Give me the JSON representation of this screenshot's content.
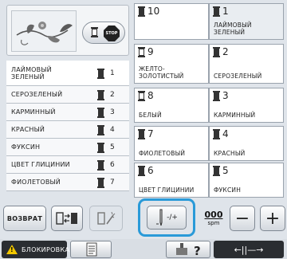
{
  "list": {
    "items": [
      {
        "name": "ЛАЙМОВЫЙ\nЗЕЛЕНЫЙ",
        "num": "1"
      },
      {
        "name": "СЕРОЗЕЛЕНЫЙ",
        "num": "2"
      },
      {
        "name": "КАРМИННЫЙ",
        "num": "3"
      },
      {
        "name": "КРАСНЫЙ",
        "num": "4"
      },
      {
        "name": "ФУКСИН",
        "num": "5"
      },
      {
        "name": "ЦВЕТ ГЛИЦИНИИ",
        "num": "6"
      },
      {
        "name": "ФИОЛЕТОВЫЙ",
        "num": "7"
      }
    ]
  },
  "grid": {
    "cells": [
      {
        "num": "10",
        "name": ""
      },
      {
        "num": "1",
        "name": "ЛАЙМОВЫЙ\nЗЕЛЕНЫЙ"
      },
      {
        "num": "9",
        "name": "ЖЕЛТО-\nЗОЛОТИСТЫЙ"
      },
      {
        "num": "2",
        "name": "СЕРОЗЕЛЕНЫЙ"
      },
      {
        "num": "8",
        "name": "БЕЛЫЙ"
      },
      {
        "num": "3",
        "name": "КАРМИННЫЙ"
      },
      {
        "num": "7",
        "name": "ФИОЛЕТОВЫЙ"
      },
      {
        "num": "4",
        "name": "КРАСНЫЙ"
      },
      {
        "num": "6",
        "name": "ЦВЕТ ГЛИЦИНИИ"
      },
      {
        "num": "5",
        "name": "ФУКСИН"
      }
    ]
  },
  "buttons": {
    "back": "ВОЗВРАТ",
    "needle": "-/+",
    "speed_value": "000",
    "speed_unit": "spm",
    "minus": "−",
    "plus": "+"
  },
  "stop_sign_text": "STOP",
  "footer": {
    "lock_label": "БЛОКИРОВКА",
    "help": "?",
    "nav": "←||—→"
  },
  "colors": {
    "highlight": "#2a9ad8",
    "warning": "#f2c700"
  }
}
